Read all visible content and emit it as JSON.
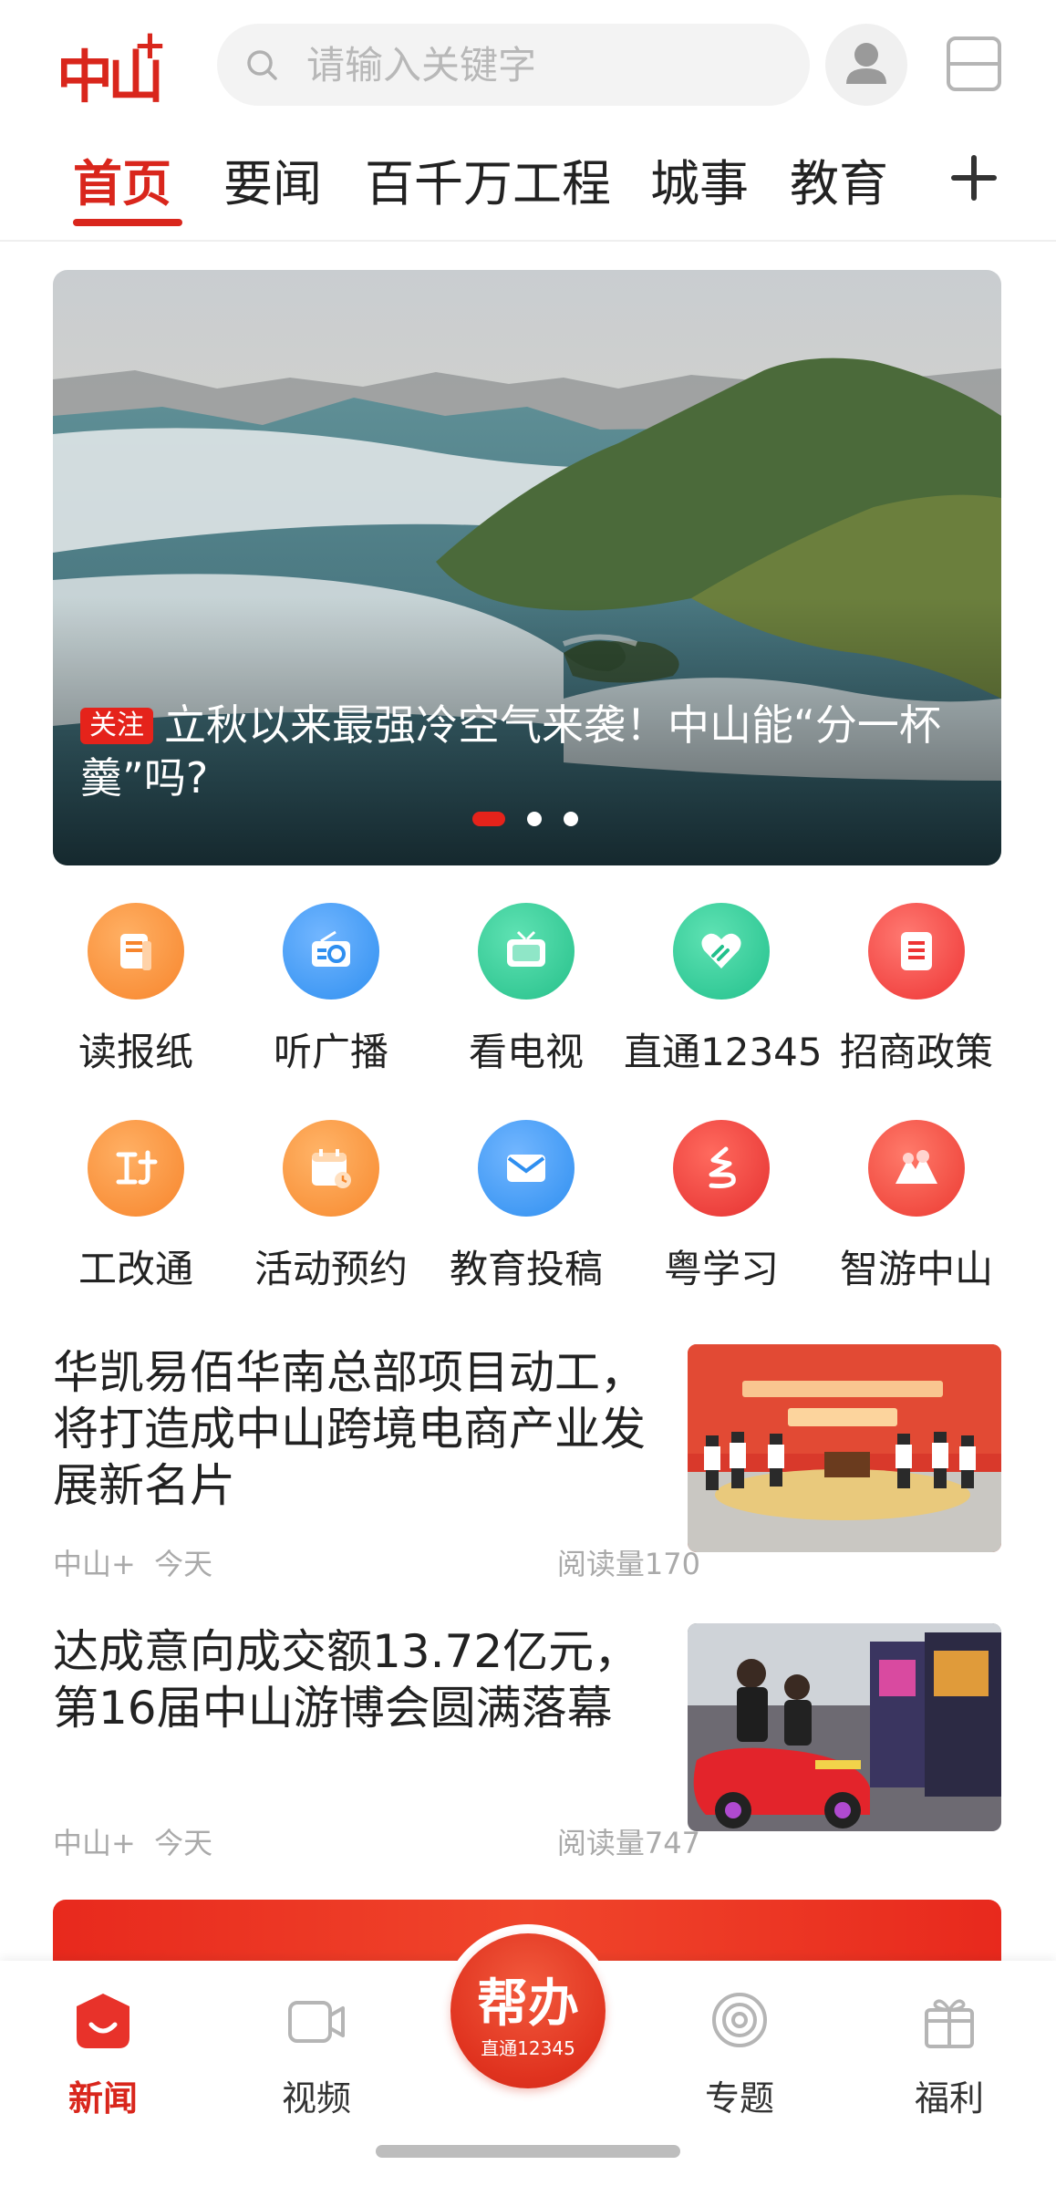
{
  "header": {
    "logo_text": "中山",
    "logo_plus": "+",
    "search_placeholder": "请输入关键字"
  },
  "tabs": [
    {
      "label": "首页",
      "active": true
    },
    {
      "label": "要闻"
    },
    {
      "label": "百千万工程"
    },
    {
      "label": "城事"
    },
    {
      "label": "教育"
    }
  ],
  "banner": {
    "tag": "关注",
    "headline": "立秋以来最强冷空气来袭！中山能“分一杯羹”吗?",
    "slides": 3,
    "active_slide": 1
  },
  "quick_links": [
    {
      "label": "读报纸",
      "icon": "newspaper-icon",
      "color": "#f7852c"
    },
    {
      "label": "听广播",
      "icon": "radio-icon",
      "color": "#2f8ff0"
    },
    {
      "label": "看电视",
      "icon": "tv-icon",
      "color": "#26c08a"
    },
    {
      "label": "直通12345",
      "icon": "heart-hand-icon",
      "color": "#22c08c"
    },
    {
      "label": "招商政策",
      "icon": "notebook-icon",
      "color": "#ee3434"
    },
    {
      "label": "工改通",
      "icon": "gonggai-icon",
      "color": "#f7852c"
    },
    {
      "label": "活动预约",
      "icon": "calendar-icon",
      "color": "#f7892e"
    },
    {
      "label": "教育投稿",
      "icon": "mail-icon",
      "color": "#2f8ff0"
    },
    {
      "label": "粤学习",
      "icon": "yue-study-icon",
      "color": "#e53030"
    },
    {
      "label": "智游中山",
      "icon": "mountain-icon",
      "color": "#ec3a32"
    }
  ],
  "news": [
    {
      "title": "华凯易佰华南总部项目动工，将打造成中山跨境电商产业发展新名片",
      "source": "中山+",
      "time": "今天",
      "reads": "阅读量170"
    },
    {
      "title": "达成意向成交额13.72亿元，第16届中山游博会圆满落幕",
      "source": "中山+",
      "time": "今天",
      "reads": "阅读量747"
    }
  ],
  "bottom_nav": {
    "items": [
      {
        "label": "新闻",
        "active": true
      },
      {
        "label": "视频"
      },
      {
        "label": "专题"
      },
      {
        "label": "福利"
      }
    ],
    "center_main": "帮办",
    "center_sub": "直通12345"
  },
  "colors": {
    "brand_red": "#d9261c",
    "text": "#222222",
    "muted": "#aaaaaa"
  }
}
